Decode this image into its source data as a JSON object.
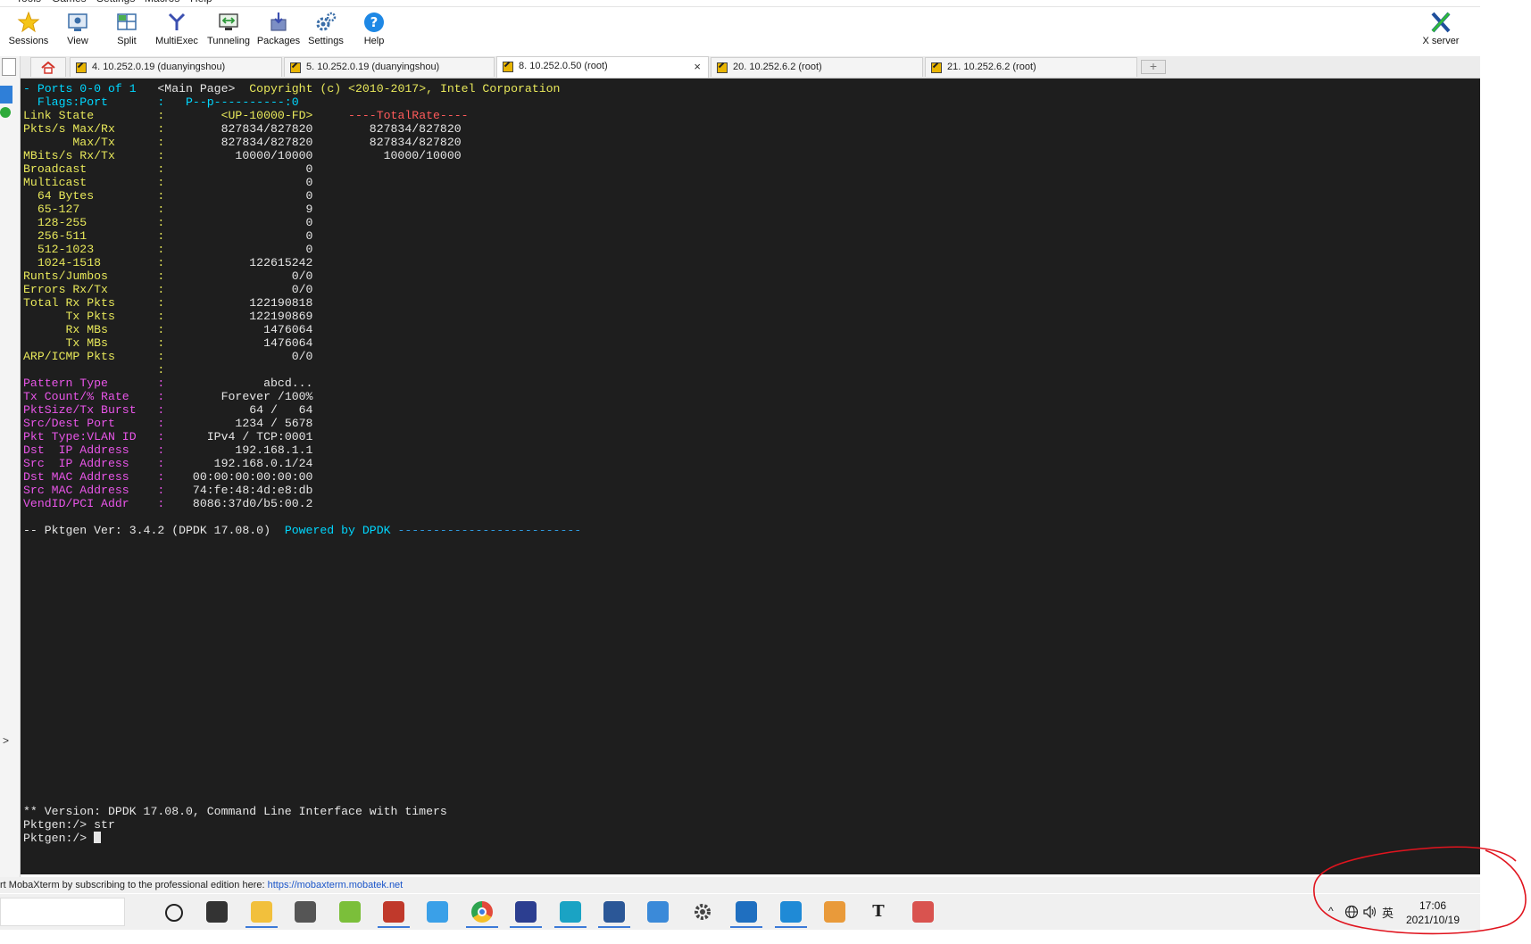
{
  "menu": {
    "items": [
      "Tools",
      "Games",
      "Settings",
      "Macros",
      "Help"
    ]
  },
  "toolbar": {
    "buttons": [
      {
        "label": "Sessions",
        "icon": "star-icon"
      },
      {
        "label": "View",
        "icon": "view-icon"
      },
      {
        "label": "Split",
        "icon": "split-icon"
      },
      {
        "label": "MultiExec",
        "icon": "multiexec-icon"
      },
      {
        "label": "Tunneling",
        "icon": "tunneling-icon"
      },
      {
        "label": "Packages",
        "icon": "packages-icon"
      },
      {
        "label": "Settings",
        "icon": "gear-icon"
      },
      {
        "label": "Help",
        "icon": "help-icon"
      }
    ],
    "xserver_label": "X server"
  },
  "tabs": [
    {
      "label": "4. 10.252.0.19 (duanyingshou)",
      "active": false
    },
    {
      "label": "5. 10.252.0.19 (duanyingshou)",
      "active": false
    },
    {
      "label": "8. 10.252.0.50 (root)",
      "active": true
    },
    {
      "label": "20. 10.252.6.2 (root)",
      "active": false
    },
    {
      "label": "21. 10.252.6.2 (root)",
      "active": false
    }
  ],
  "tab_close_symbol": "×",
  "terminal": {
    "lines": [
      [
        {
          "t": "- Ports 0-0 of 1   ",
          "c": "#00d7ff"
        },
        {
          "t": "<Main Page>  ",
          "c": "#e6e6e6"
        },
        {
          "t": "Copyright (c) <2010-2017>, Intel Corporation",
          "c": "#e8e85a"
        }
      ],
      [
        {
          "t": "  Flags:Port       :   P--p----------:0",
          "c": "#00d7ff"
        }
      ],
      [
        {
          "t": "Link State         :",
          "c": "#e8e85a"
        },
        {
          "t": "        <UP-10000-FD>",
          "c": "#e8e85a"
        },
        {
          "t": "     ----TotalRate----",
          "c": "#ff5a5a"
        }
      ],
      [
        {
          "t": "Pkts/s Max/Rx      :",
          "c": "#e8e85a"
        },
        {
          "t": "        827834/827820        827834/827820",
          "c": "#e6e6e6"
        }
      ],
      [
        {
          "t": "       Max/Tx      :",
          "c": "#e8e85a"
        },
        {
          "t": "        827834/827820        827834/827820",
          "c": "#e6e6e6"
        }
      ],
      [
        {
          "t": "MBits/s Rx/Tx      :",
          "c": "#e8e85a"
        },
        {
          "t": "          10000/10000          10000/10000",
          "c": "#e6e6e6"
        }
      ],
      [
        {
          "t": "Broadcast          :",
          "c": "#e8e85a"
        },
        {
          "t": "                    0",
          "c": "#e6e6e6"
        }
      ],
      [
        {
          "t": "Multicast          :",
          "c": "#e8e85a"
        },
        {
          "t": "                    0",
          "c": "#e6e6e6"
        }
      ],
      [
        {
          "t": "  64 Bytes         :",
          "c": "#e8e85a"
        },
        {
          "t": "                    0",
          "c": "#e6e6e6"
        }
      ],
      [
        {
          "t": "  65-127           :",
          "c": "#e8e85a"
        },
        {
          "t": "                    9",
          "c": "#e6e6e6"
        }
      ],
      [
        {
          "t": "  128-255          :",
          "c": "#e8e85a"
        },
        {
          "t": "                    0",
          "c": "#e6e6e6"
        }
      ],
      [
        {
          "t": "  256-511          :",
          "c": "#e8e85a"
        },
        {
          "t": "                    0",
          "c": "#e6e6e6"
        }
      ],
      [
        {
          "t": "  512-1023         :",
          "c": "#e8e85a"
        },
        {
          "t": "                    0",
          "c": "#e6e6e6"
        }
      ],
      [
        {
          "t": "  1024-1518        :",
          "c": "#e8e85a"
        },
        {
          "t": "            122615242",
          "c": "#e6e6e6"
        }
      ],
      [
        {
          "t": "Runts/Jumbos       :",
          "c": "#e8e85a"
        },
        {
          "t": "                  0/0",
          "c": "#e6e6e6"
        }
      ],
      [
        {
          "t": "Errors Rx/Tx       :",
          "c": "#e8e85a"
        },
        {
          "t": "                  0/0",
          "c": "#e6e6e6"
        }
      ],
      [
        {
          "t": "Total Rx Pkts      :",
          "c": "#e8e85a"
        },
        {
          "t": "            122190818",
          "c": "#e6e6e6"
        }
      ],
      [
        {
          "t": "      Tx Pkts      :",
          "c": "#e8e85a"
        },
        {
          "t": "            122190869",
          "c": "#e6e6e6"
        }
      ],
      [
        {
          "t": "      Rx MBs       :",
          "c": "#e8e85a"
        },
        {
          "t": "              1476064",
          "c": "#e6e6e6"
        }
      ],
      [
        {
          "t": "      Tx MBs       :",
          "c": "#e8e85a"
        },
        {
          "t": "              1476064",
          "c": "#e6e6e6"
        }
      ],
      [
        {
          "t": "ARP/ICMP Pkts      :",
          "c": "#e8e85a"
        },
        {
          "t": "                  0/0",
          "c": "#e6e6e6"
        }
      ],
      [
        {
          "t": "                   :",
          "c": "#e8e85a"
        }
      ],
      [
        {
          "t": "Pattern Type       :",
          "c": "#e855e8"
        },
        {
          "t": "              abcd...",
          "c": "#e6e6e6"
        }
      ],
      [
        {
          "t": "Tx Count/% Rate    :",
          "c": "#e855e8"
        },
        {
          "t": "        Forever /100%",
          "c": "#e6e6e6"
        }
      ],
      [
        {
          "t": "PktSize/Tx Burst   :",
          "c": "#e855e8"
        },
        {
          "t": "            64 /   64",
          "c": "#e6e6e6"
        }
      ],
      [
        {
          "t": "Src/Dest Port      :",
          "c": "#e855e8"
        },
        {
          "t": "          1234 / 5678",
          "c": "#e6e6e6"
        }
      ],
      [
        {
          "t": "Pkt Type:VLAN ID   :",
          "c": "#e855e8"
        },
        {
          "t": "      IPv4 / TCP:0001",
          "c": "#e6e6e6"
        }
      ],
      [
        {
          "t": "Dst  IP Address    :",
          "c": "#e855e8"
        },
        {
          "t": "          192.168.1.1",
          "c": "#e6e6e6"
        }
      ],
      [
        {
          "t": "Src  IP Address    :",
          "c": "#e855e8"
        },
        {
          "t": "       192.168.0.1/24",
          "c": "#e6e6e6"
        }
      ],
      [
        {
          "t": "Dst MAC Address    :",
          "c": "#e855e8"
        },
        {
          "t": "    00:00:00:00:00:00",
          "c": "#e6e6e6"
        }
      ],
      [
        {
          "t": "Src MAC Address    :",
          "c": "#e855e8"
        },
        {
          "t": "    74:fe:48:4d:e8:db",
          "c": "#e6e6e6"
        }
      ],
      [
        {
          "t": "VendID/PCI Addr    :",
          "c": "#e855e8"
        },
        {
          "t": "    8086:37d0/b5:00.2",
          "c": "#e6e6e6"
        }
      ],
      [
        {
          "t": "",
          "c": "#e6e6e6"
        }
      ],
      [
        {
          "t": "-- Pktgen Ver: 3.4.2 (DPDK 17.08.0)  ",
          "c": "#e6e6e6"
        },
        {
          "t": "Powered by DPDK ",
          "c": "#00d7ff"
        },
        {
          "t": "--------------------------",
          "c": "#2e9adf"
        }
      ]
    ],
    "version_line": "** Version: DPDK 17.08.0, Command Line Interface with timers",
    "prompt_line_1": "Pktgen:/> str",
    "prompt_line_2": "Pktgen:/> "
  },
  "footer": {
    "text": "rt MobaXterm by subscribing to the professional edition here:  ",
    "link": "https://mobaxterm.mobatek.net"
  },
  "taskbar": {
    "apps": [
      {
        "name": "cortana-icon",
        "color": "#222222",
        "active": false
      },
      {
        "name": "task-view-icon",
        "color": "#333333",
        "active": false
      },
      {
        "name": "file-explorer-icon",
        "color": "#f2c03c",
        "active": true
      },
      {
        "name": "mail-icon",
        "color": "#555555",
        "active": false
      },
      {
        "name": "notepad-plus-icon",
        "color": "#7bbf3a",
        "active": false
      },
      {
        "name": "mobaxterm-icon",
        "color": "#c0392b",
        "active": true
      },
      {
        "name": "browser-ie-icon",
        "color": "#3aa0e8",
        "active": false
      },
      {
        "name": "chrome-icon",
        "color": "#e24a3b",
        "active": true
      },
      {
        "name": "eclipse-icon",
        "color": "#2c3e90",
        "active": true
      },
      {
        "name": "search-app-icon",
        "color": "#1aa3c4",
        "active": true
      },
      {
        "name": "word-icon",
        "color": "#2b5797",
        "active": true
      },
      {
        "name": "remote-desktop-icon",
        "color": "#3b8ad9",
        "active": false
      },
      {
        "name": "gear-icon",
        "color": "#444444",
        "active": false
      },
      {
        "name": "wireshark-icon",
        "color": "#1f6fc0",
        "active": true
      },
      {
        "name": "vscode-icon",
        "color": "#1f8ad6",
        "active": true
      },
      {
        "name": "git-icon",
        "color": "#e99a3a",
        "active": false
      },
      {
        "name": "typora-icon",
        "color": "#222222",
        "active": false
      },
      {
        "name": "snipping-icon",
        "color": "#d9534f",
        "active": false
      }
    ]
  },
  "tray": {
    "ime": "英",
    "time": "17:06",
    "date": "2021/10/19"
  },
  "colors": {
    "terminal_bg": "#1e1e1e",
    "annotation": "#e0141e"
  }
}
